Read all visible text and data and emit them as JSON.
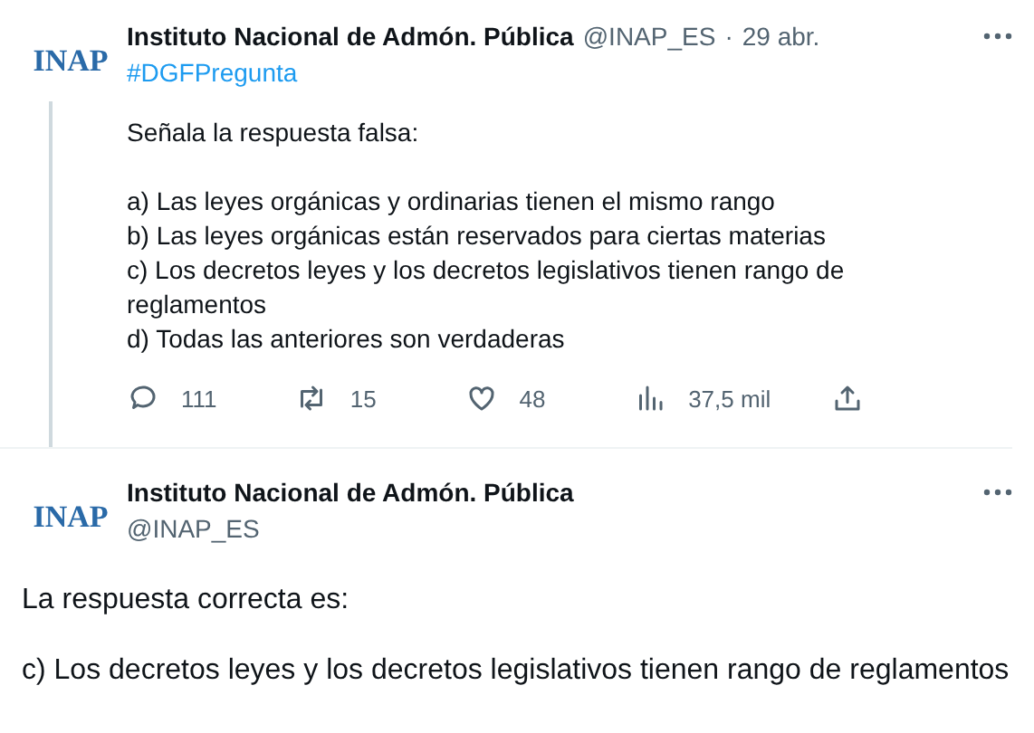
{
  "tweet": {
    "avatar_text": "INAP",
    "author": "Instituto Nacional de Admón. Pública",
    "handle": "@INAP_ES",
    "separator": "·",
    "date": "29 abr.",
    "hashtag": "#DGFPregunta",
    "paragraphs": [
      [
        "Señala la respuesta falsa:"
      ],
      [
        "a) Las leyes orgánicas y ordinarias tienen el mismo rango",
        "b) Las leyes orgánicas están reservados para ciertas materias",
        "c) Los decretos leyes y los decretos legislativos tienen rango de reglamentos",
        "d) Todas las anteriores son verdaderas"
      ]
    ],
    "actions": [
      {
        "kind": "reply",
        "count": "111"
      },
      {
        "kind": "retweet",
        "count": "15"
      },
      {
        "kind": "like",
        "count": "48"
      },
      {
        "kind": "views",
        "count": "37,5 mil"
      },
      {
        "kind": "share"
      }
    ]
  },
  "reply": {
    "avatar_text": "INAP",
    "author": "Instituto Nacional de Admón. Pública",
    "handle": "@INAP_ES",
    "paragraphs": [
      "La respuesta correcta es:",
      "c) Los decretos leyes y los decretos legislativos tienen rango de reglamentos"
    ]
  }
}
